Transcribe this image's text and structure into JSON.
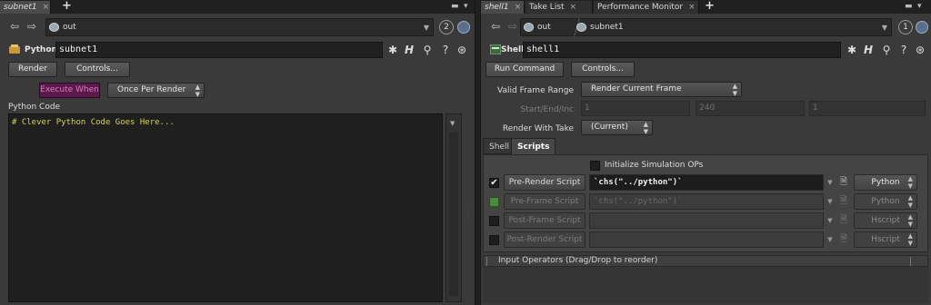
{
  "left": {
    "tabs": [
      {
        "label": "subnet1",
        "close": "×"
      }
    ],
    "add_tab": "+",
    "path": {
      "segment": "out"
    },
    "badge": "2",
    "node": {
      "type": "Python",
      "name": "subnet1"
    },
    "buttons": {
      "render": "Render",
      "controls": "Controls..."
    },
    "execute": {
      "label": "Execute When",
      "value": "Once Per Render"
    },
    "code": {
      "label": "Python Code",
      "text": "# Clever Python Code Goes Here..."
    }
  },
  "right": {
    "tabs": [
      {
        "label": "shell1",
        "close": "×"
      },
      {
        "label": "Take List",
        "close": "×"
      },
      {
        "label": "Performance Monitor",
        "close": "×"
      }
    ],
    "add_tab": "+",
    "path": {
      "segment1": "out",
      "segment2": "subnet1"
    },
    "badge": "1",
    "node": {
      "type": "Shell",
      "name": "shell1"
    },
    "buttons": {
      "run": "Run Command",
      "controls": "Controls..."
    },
    "frame_range": {
      "label": "Valid Frame Range",
      "value": "Render Current Frame"
    },
    "start_end": {
      "label": "Start/End/Inc",
      "values": [
        "1",
        "240",
        "1"
      ]
    },
    "take": {
      "label": "Render With Take",
      "value": "(Current)"
    },
    "subtabs": [
      "Shell",
      "Scripts"
    ],
    "init_sim": "Initialize Simulation OPs",
    "scripts": [
      {
        "label": "Pre-Render Script",
        "value": "`chs(\"../python\")`",
        "lang": "Python"
      },
      {
        "label": "Pre-Frame Script",
        "value": "`chs(\"../python\")`",
        "lang": "Python"
      },
      {
        "label": "Post-Frame Script",
        "value": "",
        "lang": "Hscript"
      },
      {
        "label": "Post-Render Script",
        "value": "",
        "lang": "Hscript"
      }
    ],
    "input_ops": "Input Operators (Drag/Drop to reorder)"
  },
  "colors": {
    "execute_bg": "#5b1a4a",
    "execute_text": "#d97ac4",
    "code_text": "#d7d05a"
  }
}
